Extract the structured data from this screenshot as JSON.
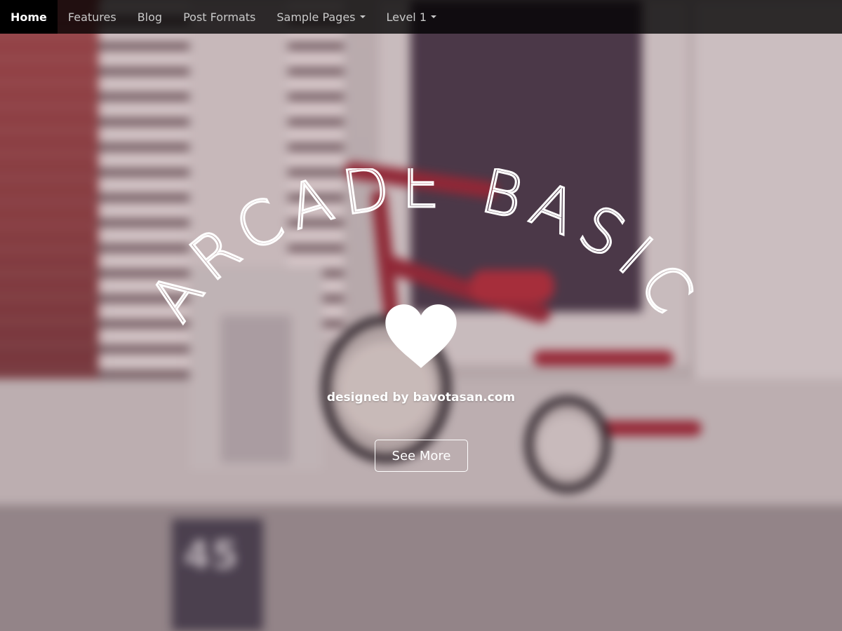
{
  "nav": {
    "items": [
      {
        "label": "Home",
        "active": true,
        "dropdown": false
      },
      {
        "label": "Features",
        "active": false,
        "dropdown": false
      },
      {
        "label": "Blog",
        "active": false,
        "dropdown": false
      },
      {
        "label": "Post Formats",
        "active": false,
        "dropdown": false
      },
      {
        "label": "Sample Pages",
        "active": false,
        "dropdown": true
      },
      {
        "label": "Level 1",
        "active": false,
        "dropdown": true
      }
    ]
  },
  "hero": {
    "title": "ARCADE BASIC",
    "icon": "heart-icon",
    "tagline": "designed by bavotasan.com",
    "button_label": "See More",
    "background_number": "45"
  },
  "colors": {
    "navbar_bg": "#1b1b1b",
    "active_tab_bg": "#000000",
    "text_white": "#ffffff",
    "tricycle_red": "#a22c3a"
  }
}
